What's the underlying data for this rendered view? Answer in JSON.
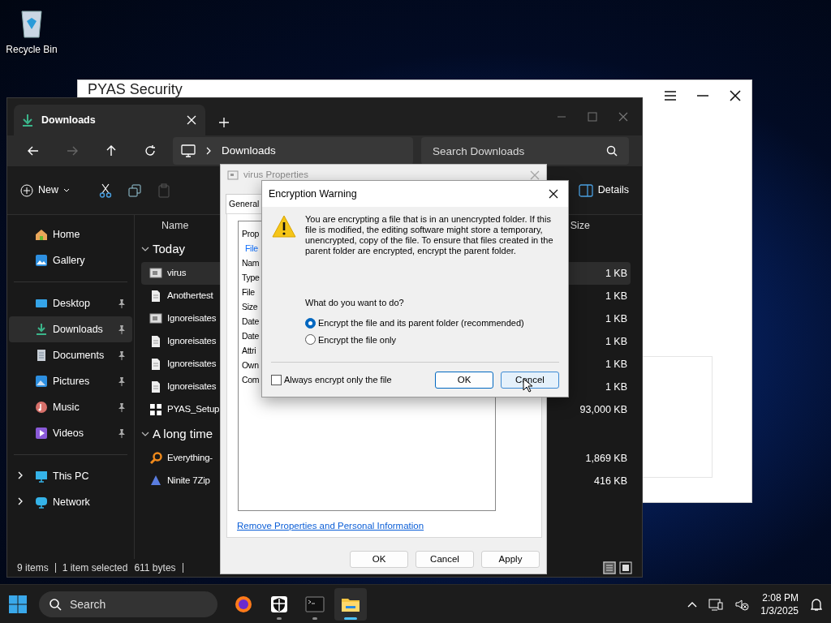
{
  "desktop_icons": [
    {
      "label": "Recycle Bin"
    }
  ],
  "pyas_window": {
    "title": "PYAS Security"
  },
  "explorer": {
    "tab": {
      "label": "Downloads",
      "selected": true
    },
    "address": "Downloads",
    "search": {
      "placeholder": "Search Downloads"
    },
    "toolbar": {
      "new": "New",
      "details": "Details"
    },
    "sidebar": [
      [
        {
          "label": "Home",
          "kind": "home",
          "pinned": false,
          "selected": false
        },
        {
          "label": "Gallery",
          "kind": "gallery",
          "pinned": false,
          "selected": false
        }
      ],
      [
        {
          "label": "Desktop",
          "kind": "desktop",
          "pinned": true,
          "selected": false
        },
        {
          "label": "Downloads",
          "kind": "downloads",
          "pinned": true,
          "selected": true
        },
        {
          "label": "Documents",
          "kind": "documents",
          "pinned": true,
          "selected": false
        },
        {
          "label": "Pictures",
          "kind": "pictures",
          "pinned": true,
          "selected": false
        },
        {
          "label": "Music",
          "kind": "music",
          "pinned": true,
          "selected": false
        },
        {
          "label": "Videos",
          "kind": "videos",
          "pinned": true,
          "selected": false
        }
      ],
      [
        {
          "label": "This PC",
          "kind": "pc",
          "pinned": false,
          "selected": false,
          "expanded": false
        },
        {
          "label": "Network",
          "kind": "network",
          "pinned": false,
          "selected": false,
          "expanded": false
        }
      ]
    ],
    "columns": [
      "Name",
      "Size"
    ],
    "groups": [
      {
        "label": "Today",
        "expanded": true,
        "files": [
          {
            "name": "virus",
            "size": "1 KB",
            "kind": "script",
            "selected": true
          },
          {
            "name": "Anothertest",
            "size": "1 KB",
            "kind": "document",
            "selected": false
          },
          {
            "name": "Ignoreisates",
            "size": "1 KB",
            "kind": "script",
            "selected": false
          },
          {
            "name": "Ignoreisates",
            "size": "1 KB",
            "kind": "document",
            "selected": false
          },
          {
            "name": "Ignoreisates",
            "size": "1 KB",
            "kind": "document",
            "selected": false
          },
          {
            "name": "Ignoreisates",
            "size": "1 KB",
            "kind": "document",
            "selected": false
          },
          {
            "name": "PYAS_Setup",
            "size": "93,000 KB",
            "kind": "installer",
            "selected": false
          }
        ]
      },
      {
        "label": "A long time",
        "expanded": true,
        "files": [
          {
            "name": "Everything-",
            "size": "1,869 KB",
            "kind": "magnifier",
            "selected": false
          },
          {
            "name": "Ninite 7Zip",
            "size": "416 KB",
            "kind": "ninite",
            "selected": false
          }
        ]
      }
    ],
    "status": {
      "items": "9 items",
      "selection": "1 item selected",
      "bytes": "611 bytes"
    },
    "view_buttons": [
      {
        "kind": "details",
        "selected": true
      },
      {
        "kind": "tiles",
        "selected": false
      }
    ]
  },
  "properties": {
    "title": "virus Properties",
    "tabs": [
      {
        "label": "General",
        "selected": true
      }
    ],
    "section_header": "Prop",
    "file_label": "File",
    "field_labels": [
      "Nam",
      "Type",
      "File",
      "Size",
      "Date",
      "Date",
      "Attri",
      "Own",
      "Com"
    ],
    "link": "Remove Properties and Personal Information",
    "buttons": [
      {
        "label": "OK"
      },
      {
        "label": "Cancel"
      },
      {
        "label": "Apply"
      }
    ]
  },
  "encryption_warning": {
    "title": "Encryption Warning",
    "message": "You are encrypting a file that is in an unencrypted folder. If this file is modified, the editing software might store a temporary, unencrypted, copy of the file. To ensure that files created in the parent folder are encrypted, encrypt the parent folder.",
    "question": "What do you want to do?",
    "options": [
      {
        "label": "Encrypt the file and its parent folder (recommended)",
        "selected": true
      },
      {
        "label": "Encrypt the file only",
        "selected": false
      }
    ],
    "checkbox": {
      "label": "Always encrypt only the file",
      "checked": false
    },
    "buttons": [
      {
        "label": "OK",
        "default": true,
        "hovered": false
      },
      {
        "label": "Cancel",
        "default": false,
        "hovered": true
      }
    ]
  },
  "taskbar": {
    "search": {
      "placeholder": "Search"
    },
    "apps": [
      {
        "kind": "firefox",
        "running": false,
        "selected": false
      },
      {
        "kind": "shield",
        "running": true,
        "selected": false
      },
      {
        "kind": "terminal",
        "running": true,
        "selected": false
      },
      {
        "kind": "folder",
        "running": true,
        "selected": true
      }
    ],
    "time": "2:08 PM",
    "date": "1/3/2025"
  }
}
